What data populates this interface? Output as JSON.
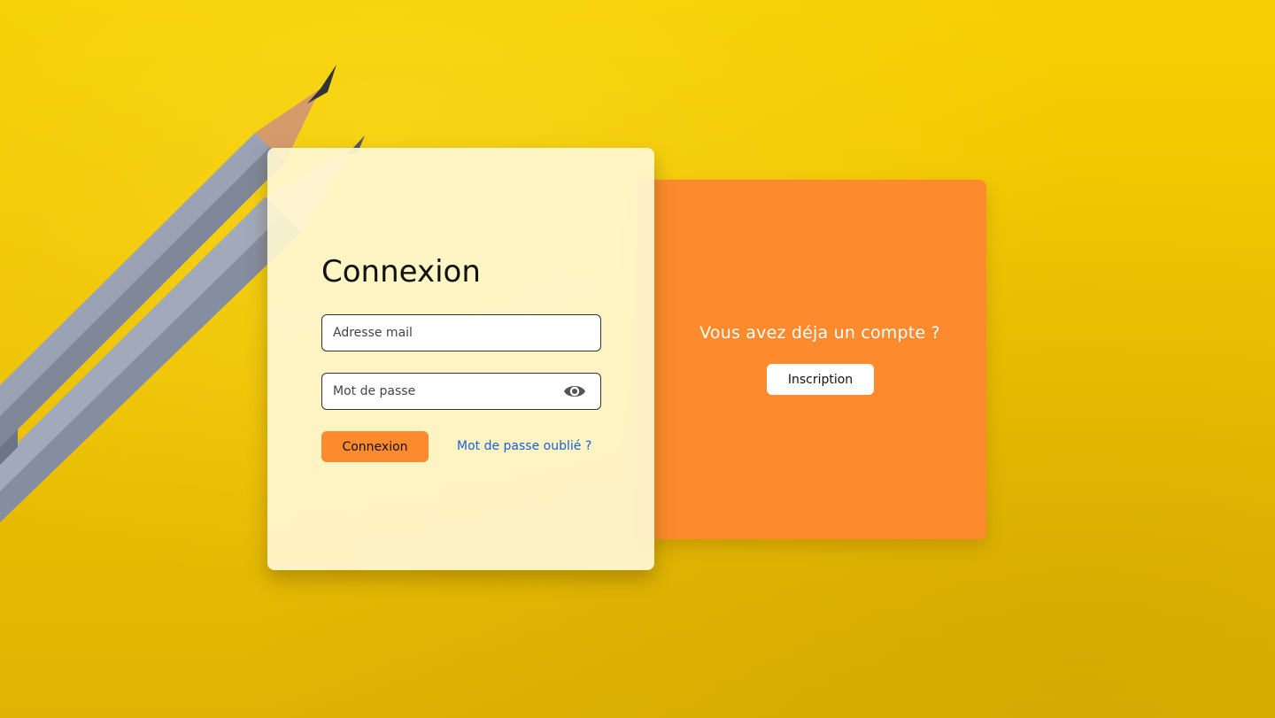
{
  "login": {
    "title": "Connexion",
    "email_placeholder": "Adresse mail",
    "email_value": "",
    "password_placeholder": "Mot de passe",
    "password_value": "",
    "show_password_icon": "eye-icon",
    "submit_label": "Connexion",
    "forgot_link": "Mot de passe oublié ?"
  },
  "signup": {
    "question": "Vous avez déja un compte ?",
    "button_label": "Inscription"
  },
  "colors": {
    "background": "#f2c802",
    "accent": "#fe8a2e",
    "card": "#fff6d2",
    "link": "#1a5fd6"
  }
}
